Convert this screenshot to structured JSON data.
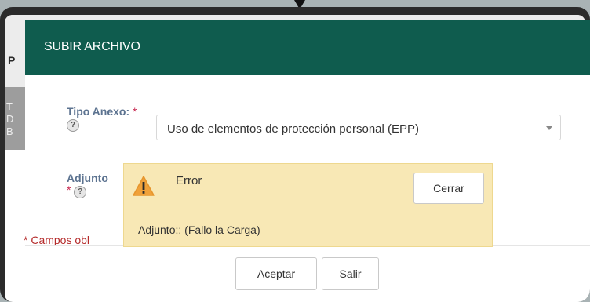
{
  "background": {
    "column_header": "P",
    "row_lines": [
      "T",
      "D",
      "B"
    ]
  },
  "modal": {
    "title": "SUBIR ARCHIVO",
    "header_color": "#0f5c4e",
    "fields": {
      "tipo_label": "Tipo Anexo:",
      "tipo_required": "*",
      "tipo_value": "Uso de elementos de protección personal (EPP)",
      "adjunto_label": "Adjunto",
      "adjunto_required": "*"
    },
    "help_icon_glyph": "?",
    "required_note": "* Campos obl",
    "buttons": {
      "accept": "Aceptar",
      "exit": "Salir"
    }
  },
  "alert": {
    "title": "Error",
    "close_label": "Cerrar",
    "message": "Adjunto:: (Fallo la Carga)",
    "icon": "warning-icon",
    "background_color": "#f8e8b5"
  }
}
